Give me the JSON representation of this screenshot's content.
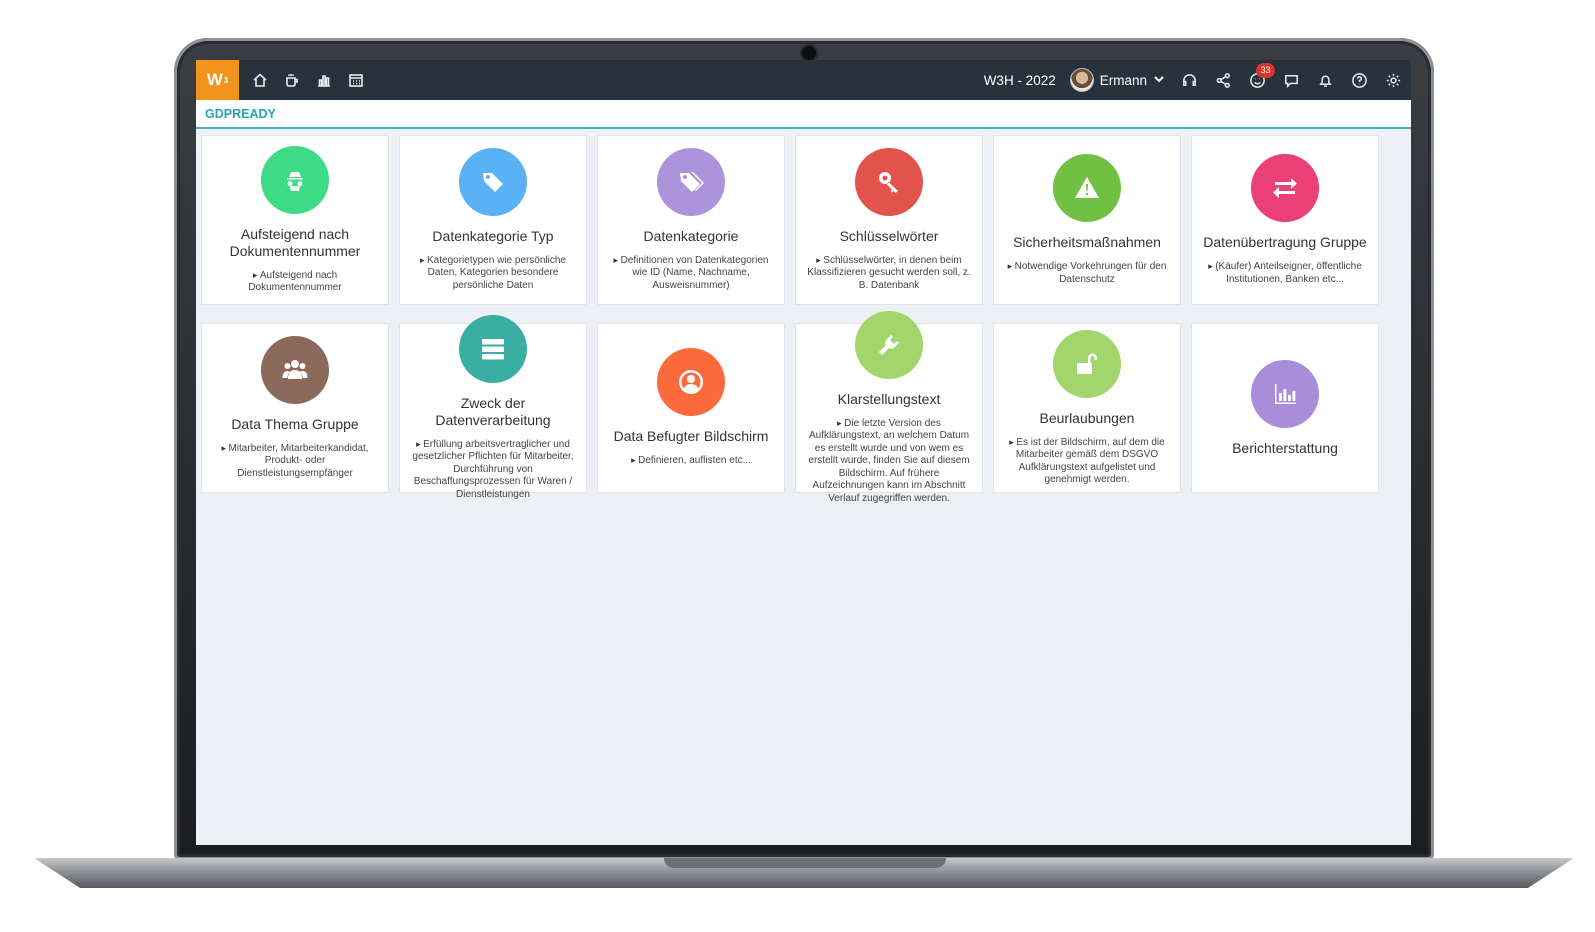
{
  "app": {
    "logo_text": "W",
    "logo_sup": "3",
    "company": "W3H - 2022",
    "user_name": "Ermann",
    "notification_count": "33",
    "module_title": "GDPREADY",
    "accent_color": "#f0941c",
    "topbar_color": "#27323d"
  },
  "nav_icons": [
    "home-icon",
    "coffee-icon",
    "bar-chart-icon",
    "calendar-icon"
  ],
  "right_icons": [
    "headset-icon",
    "share-icon",
    "smiley-icon",
    "chat-icon",
    "bell-icon",
    "help-icon",
    "gear-icon"
  ],
  "cards": [
    {
      "title": "Aufsteigend nach Dokumentennummer",
      "desc": "Aufsteigend nach Dokumentennummer",
      "color": "#3ddb86",
      "icon": "spy-icon"
    },
    {
      "title": "Datenkategorie Typ",
      "desc": "Kategorietypen wie persönliche Daten, Kategorien besondere persönliche Daten",
      "color": "#5bb1f5",
      "icon": "tag-icon"
    },
    {
      "title": "Datenkategorie",
      "desc": "Definitionen von Datenkategorien wie ID (Name, Nachname, Ausweisnummer)",
      "color": "#ad93dc",
      "icon": "tags-icon"
    },
    {
      "title": "Schlüsselwörter",
      "desc": "Schlüsselwörter, in denen beim Klassifizieren gesucht werden soll, z. B. Datenbank",
      "color": "#e1534b",
      "icon": "key-icon"
    },
    {
      "title": "Sicherheitsmaßnahmen",
      "desc": "Notwendige Vorkehrungen für den Datenschutz",
      "color": "#72c043",
      "icon": "warning-icon"
    },
    {
      "title": "Datenübertragung Gruppe",
      "desc": "(Käufer) Anteilseigner, öffentliche Institutionen, Banken etc...",
      "color": "#ea3f77",
      "icon": "exchange-icon"
    },
    {
      "title": "Data Thema Gruppe",
      "desc": "Mitarbeiter, Mitarbeiterkandidat, Produkt- oder Dienstleistungsempfänger",
      "color": "#8b6a5c",
      "icon": "users-icon"
    },
    {
      "title": "Zweck der Datenverarbeitung",
      "desc": "Erfüllung arbeitsvertraglicher und gesetzlicher Pflichten für Mitarbeiter, Durchführung von Beschaffungsprozessen für Waren / Dienstleistungen",
      "color": "#3aaea3",
      "icon": "server-icon"
    },
    {
      "title": "Data Befugter Bildschirm",
      "desc": "Definieren, auflisten etc...",
      "color": "#fd6a3c",
      "icon": "user-circle-icon"
    },
    {
      "title": "Klarstellungstext",
      "desc": "Die letzte Version des Aufklärungstext, an welchem Datum es erstellt wurde und von wem es erstellt wurde, finden Sie auf diesem Bildschirm. Auf frühere Aufzeichnungen kann im Abschnitt Verlauf zugegriffen werden.",
      "color": "#a2d56b",
      "icon": "plug-icon"
    },
    {
      "title": "Beurlaubungen",
      "desc": "Es ist der Bildschirm, auf dem die Mitarbeiter gemäß dem DSGVO Aufklärungstext aufgelistet und genehmigt werden.",
      "color": "#a2d56b",
      "icon": "unlock-icon"
    },
    {
      "title": "Berichterstattung",
      "desc": "",
      "color": "#a98ddb",
      "icon": "report-chart-icon"
    }
  ]
}
